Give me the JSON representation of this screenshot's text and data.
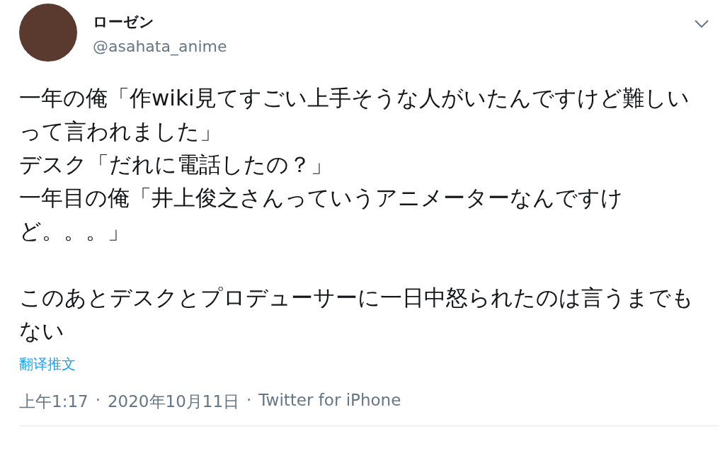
{
  "author": {
    "name": "ローゼン",
    "handle": "@asahata_anime"
  },
  "sections": [
    [
      "一年の俺「作wiki見てすごい上手そうな人がいたんですけど難しいって言われました」",
      "デスク「だれに電話したの？」",
      "一年目の俺「井上俊之さんっていうアニメーターなんですけど。。。」"
    ],
    [
      "このあとデスクとプロデューサーに一日中怒られたのは言うまでもない"
    ]
  ],
  "translate_link": "翻译推文",
  "meta": {
    "time": "上午1:17",
    "separator_1": "·",
    "date": "2020年10月11日",
    "separator_2": "·",
    "source": "Twitter for iPhone"
  }
}
